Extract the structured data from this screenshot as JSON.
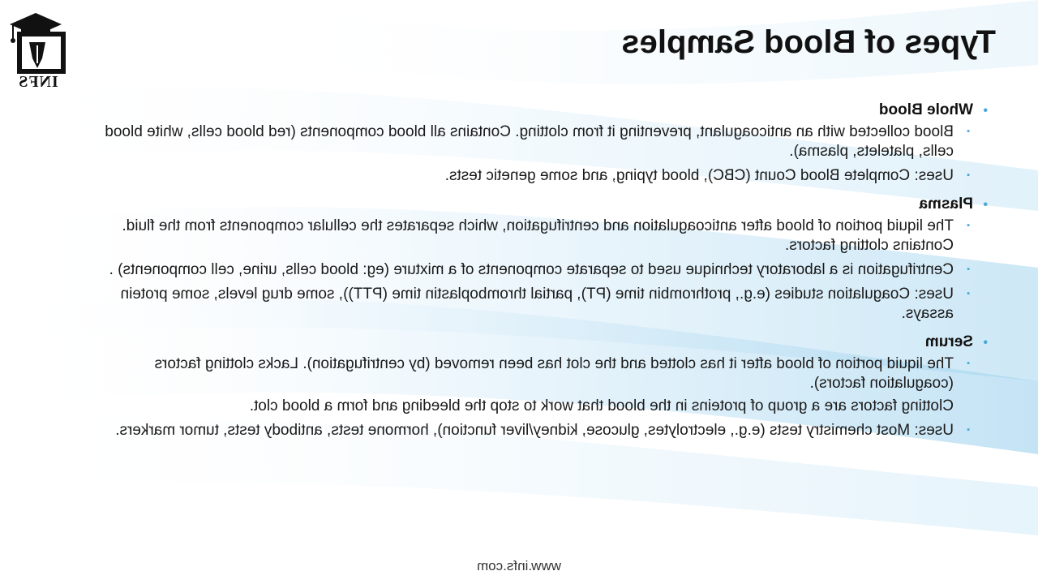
{
  "slide": {
    "title": "Types of Blood Samples",
    "logo_text": "INFS",
    "footer": "www.infs.com"
  },
  "sections": [
    {
      "heading": "Whole Blood",
      "items": [
        {
          "text": "Blood collected with an anticoagulant, preventing it from clotting. Contains all blood components (red blood cells, white blood cells, platelets, plasma)."
        },
        {
          "text": "Uses: Complete Blood Count (CBC), blood typing, and some genetic tests."
        }
      ]
    },
    {
      "heading": "Plasma",
      "items": [
        {
          "text": "The liquid portion of blood after anticoagulation and centrifugation, which separates the cellular components from the fluid. Contains clotting factors."
        },
        {
          "text": "Centrifugation is a laboratory technique used to separate components of a mixture (eg: blood cells, urine, cell components) ."
        },
        {
          "text": "Uses: Coagulation studies (e.g., prothrombin time (PT), partial thromboplastin time (PTT)), some drug levels, some protein assays."
        }
      ]
    },
    {
      "heading": "Serum",
      "items": [
        {
          "text": "The liquid portion of blood after it has clotted and the clot has been removed (by centrifugation). Lacks clotting factors (coagulation factors).",
          "sub": "Clotting factors are a group of proteins in the blood that work to stop the bleeding and form a blood clot."
        },
        {
          "text": "Uses: Most chemistry tests (e.g., electrolytes, glucose, kidney/liver function), hormone tests, antibody tests, tumor markers."
        }
      ]
    }
  ],
  "colors": {
    "accent": "#4aa8d8",
    "wave_light": "#dff0fa",
    "wave_mid": "#b9def2"
  }
}
